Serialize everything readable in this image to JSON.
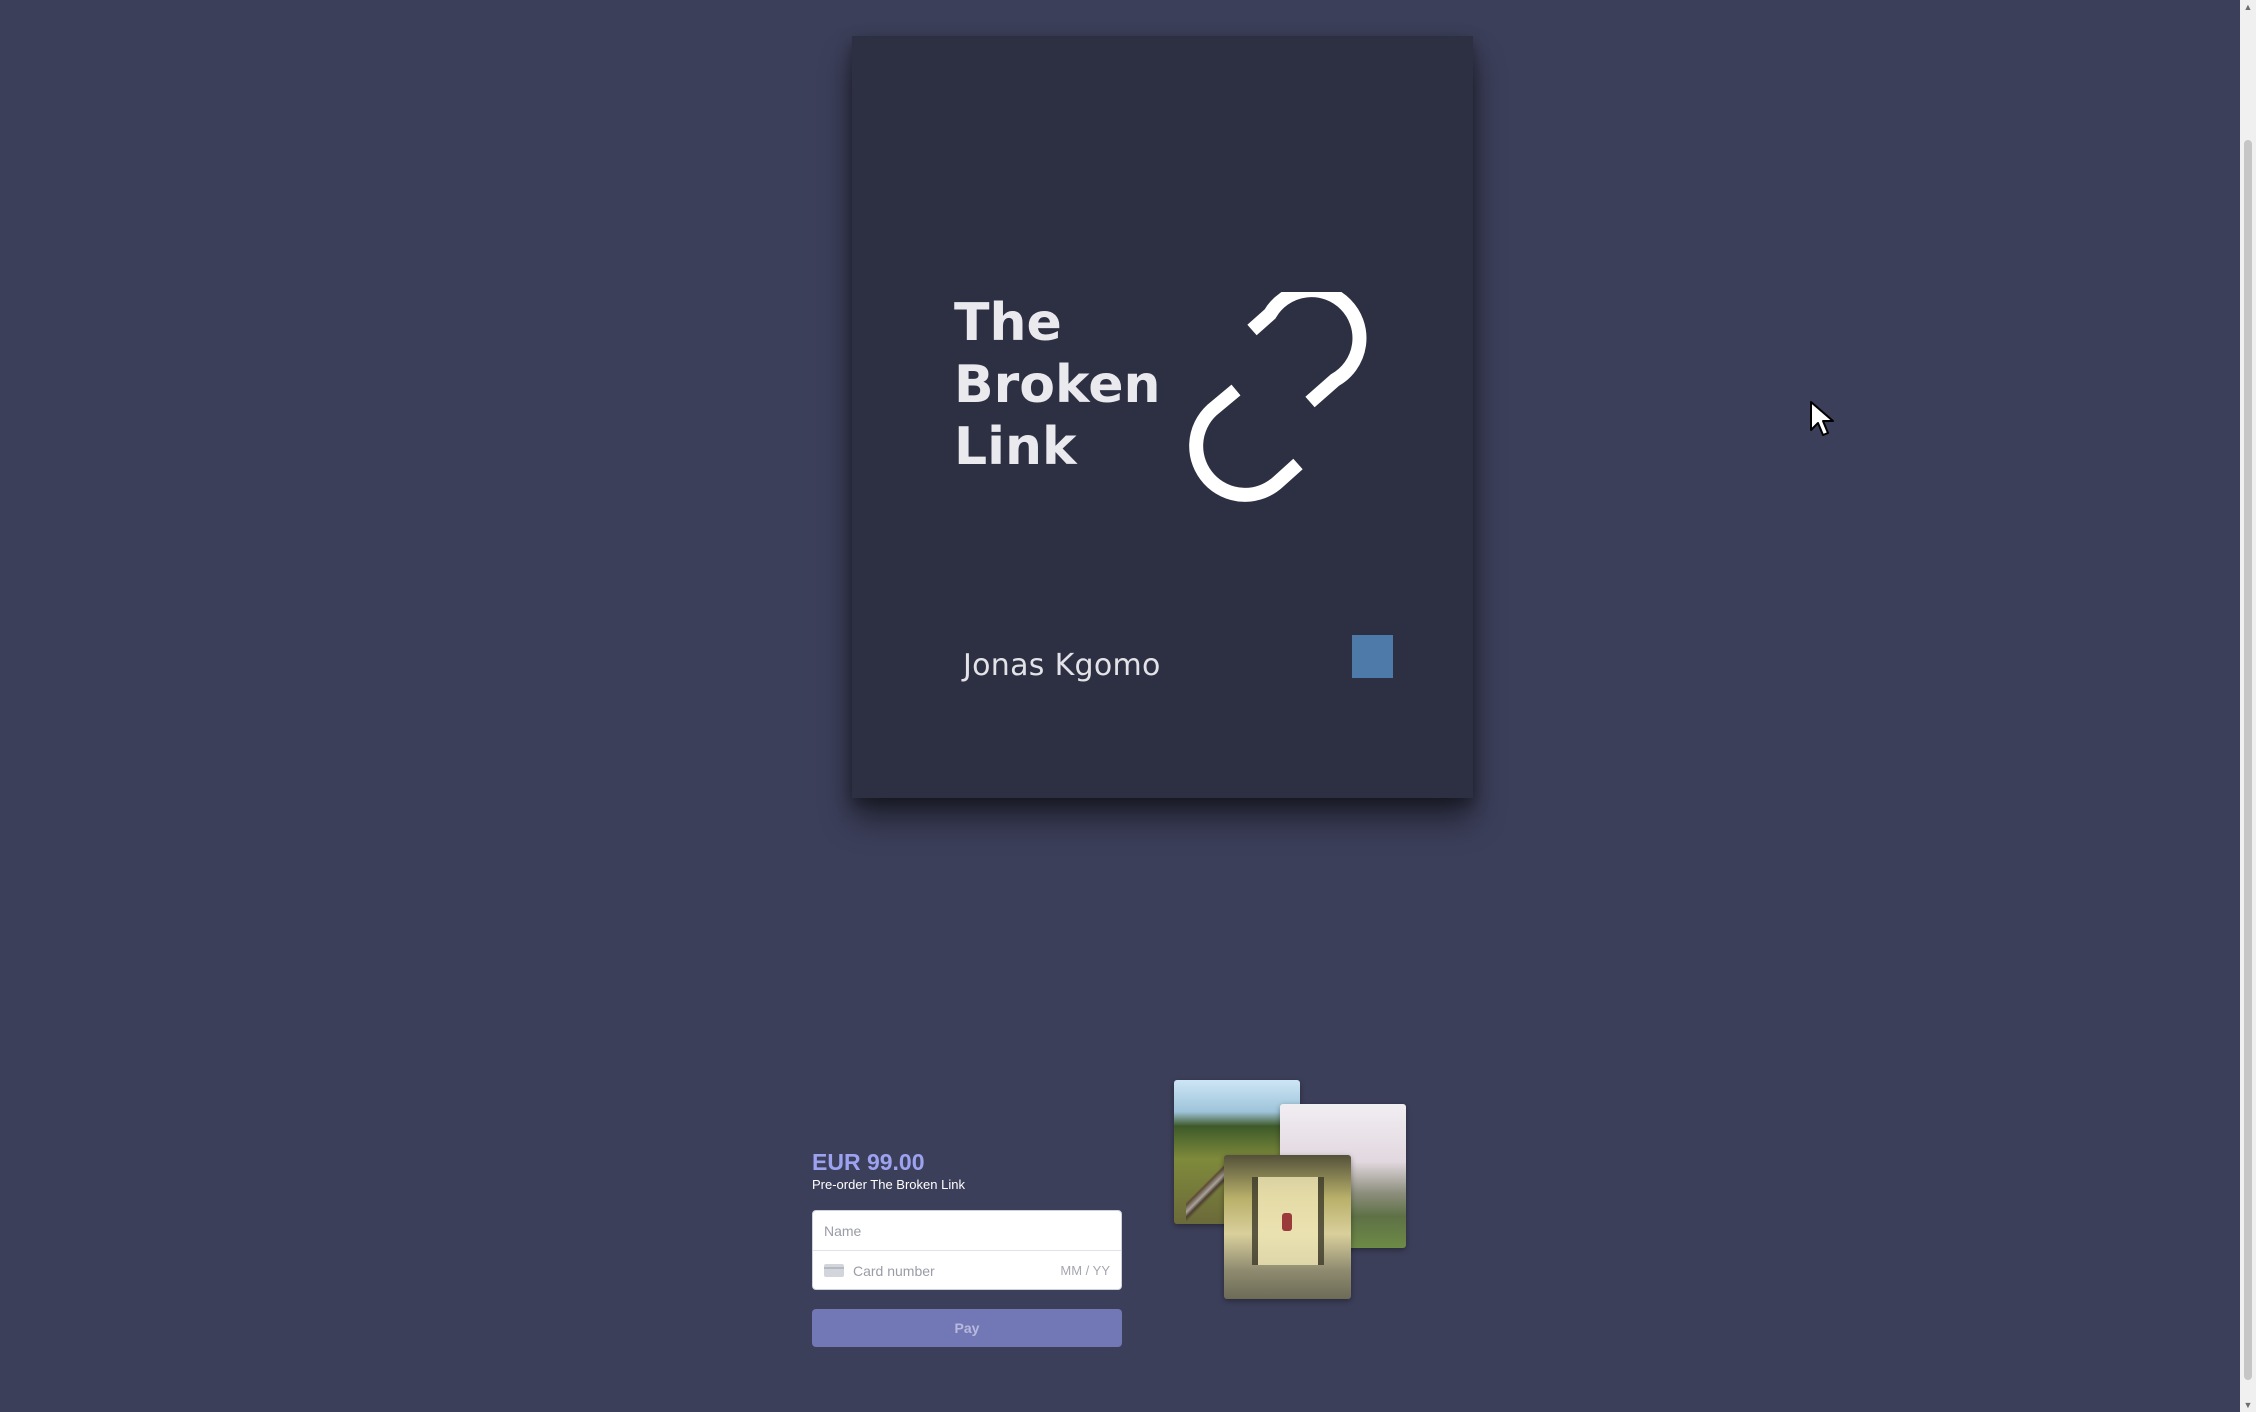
{
  "book": {
    "title_lines": [
      "The",
      "Broken",
      "Link"
    ],
    "author": "Jonas Kgomo",
    "icon": "broken-link-icon",
    "accent_color": "#4e7aaa"
  },
  "checkout": {
    "price": "EUR 99.00",
    "description": "Pre-order The Broken Link",
    "name_placeholder": "Name",
    "card_number_placeholder": "Card number",
    "expiry_placeholder": "MM / YY",
    "pay_label": "Pay",
    "price_color": "#9ca2f0",
    "button_color": "#7277b6"
  },
  "photos": [
    "railway-photo",
    "hills-photo",
    "train-interior-photo"
  ],
  "colors": {
    "background": "#3c3f5a",
    "cover": "#2d2f42"
  }
}
